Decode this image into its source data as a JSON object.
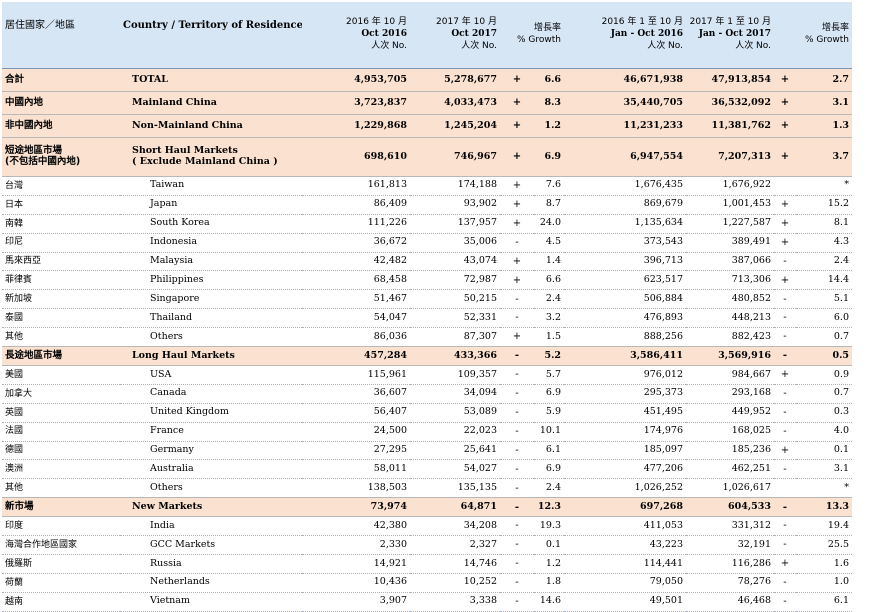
{
  "header": {
    "col_zh": "居住國家／地區",
    "col_en": "Country / Territory of Residence",
    "oct2016": {
      "line1": "2016 年 10 月",
      "line2": "Oct 2016",
      "line3": "人次  No."
    },
    "oct2017": {
      "line1": "2017 年 10 月",
      "line2": "Oct 2017",
      "line3": "人次  No."
    },
    "growth_oct": {
      "line1": "增長率",
      "line2": "% Growth"
    },
    "ytd2016": {
      "line1": "2016 年 1 至 10 月",
      "line2": "Jan - Oct 2016",
      "line3": "人次  No."
    },
    "ytd2017": {
      "line1": "2017 年 1 至 10 月",
      "line2": "Jan - Oct 2017",
      "line3": "人次  No."
    },
    "growth_ytd": {
      "line1": "增長率",
      "line2": "% Growth"
    }
  },
  "rows": [
    {
      "type": "summary",
      "zh": "合計",
      "en": "TOTAL",
      "oct16": "4,953,705",
      "oct17": "5,278,677",
      "s1": "+",
      "g1": "6.6",
      "ytd16": "46,671,938",
      "ytd17": "47,913,854",
      "s2": "+",
      "g2": "2.7"
    },
    {
      "type": "summary",
      "zh": "中國內地",
      "en": "Mainland China",
      "oct16": "3,723,837",
      "oct17": "4,033,473",
      "s1": "+",
      "g1": "8.3",
      "ytd16": "35,440,705",
      "ytd17": "36,532,092",
      "s2": "+",
      "g2": "3.1"
    },
    {
      "type": "summary",
      "zh": "非中國內地",
      "en": "Non-Mainland China",
      "oct16": "1,229,868",
      "oct17": "1,245,204",
      "s1": "+",
      "g1": "1.2",
      "ytd16": "11,231,233",
      "ytd17": "11,381,762",
      "s2": "+",
      "g2": "1.3"
    },
    {
      "type": "cat2",
      "zh": "短途地區市場",
      "zh2": "(不包括中國內地)",
      "en": "Short Haul Markets",
      "en2": "( Exclude Mainland China )",
      "oct16": "698,610",
      "oct17": "746,967",
      "s1": "+",
      "g1": "6.9",
      "ytd16": "6,947,554",
      "ytd17": "7,207,313",
      "s2": "+",
      "g2": "3.7"
    },
    {
      "type": "sub",
      "zh": "台灣",
      "en": "Taiwan",
      "oct16": "161,813",
      "oct17": "174,188",
      "s1": "+",
      "g1": "7.6",
      "ytd16": "1,676,435",
      "ytd17": "1,676,922",
      "s2": "",
      "g2": "*"
    },
    {
      "type": "sub",
      "zh": "日本",
      "en": "Japan",
      "oct16": "86,409",
      "oct17": "93,902",
      "s1": "+",
      "g1": "8.7",
      "ytd16": "869,679",
      "ytd17": "1,001,453",
      "s2": "+",
      "g2": "15.2"
    },
    {
      "type": "sub",
      "zh": "南韓",
      "en": "South Korea",
      "oct16": "111,226",
      "oct17": "137,957",
      "s1": "+",
      "g1": "24.0",
      "ytd16": "1,135,634",
      "ytd17": "1,227,587",
      "s2": "+",
      "g2": "8.1"
    },
    {
      "type": "sub",
      "zh": "印尼",
      "en": "Indonesia",
      "oct16": "36,672",
      "oct17": "35,006",
      "s1": "-",
      "g1": "4.5",
      "ytd16": "373,543",
      "ytd17": "389,491",
      "s2": "+",
      "g2": "4.3"
    },
    {
      "type": "sub",
      "zh": "馬來西亞",
      "en": "Malaysia",
      "oct16": "42,482",
      "oct17": "43,074",
      "s1": "+",
      "g1": "1.4",
      "ytd16": "396,713",
      "ytd17": "387,066",
      "s2": "-",
      "g2": "2.4"
    },
    {
      "type": "sub",
      "zh": "菲律賓",
      "en": "Philippines",
      "oct16": "68,458",
      "oct17": "72,987",
      "s1": "+",
      "g1": "6.6",
      "ytd16": "623,517",
      "ytd17": "713,306",
      "s2": "+",
      "g2": "14.4"
    },
    {
      "type": "sub",
      "zh": "新加坡",
      "en": "Singapore",
      "oct16": "51,467",
      "oct17": "50,215",
      "s1": "-",
      "g1": "2.4",
      "ytd16": "506,884",
      "ytd17": "480,852",
      "s2": "-",
      "g2": "5.1"
    },
    {
      "type": "sub",
      "zh": "泰國",
      "en": "Thailand",
      "oct16": "54,047",
      "oct17": "52,331",
      "s1": "-",
      "g1": "3.2",
      "ytd16": "476,893",
      "ytd17": "448,213",
      "s2": "-",
      "g2": "6.0"
    },
    {
      "type": "sub",
      "zh": "其他",
      "en": "Others",
      "oct16": "86,036",
      "oct17": "87,307",
      "s1": "+",
      "g1": "1.5",
      "ytd16": "888,256",
      "ytd17": "882,423",
      "s2": "-",
      "g2": "0.7"
    },
    {
      "type": "cat",
      "zh": "長途地區市場",
      "en": "Long Haul Markets",
      "oct16": "457,284",
      "oct17": "433,366",
      "s1": "-",
      "g1": "5.2",
      "ytd16": "3,586,411",
      "ytd17": "3,569,916",
      "s2": "-",
      "g2": "0.5"
    },
    {
      "type": "sub",
      "zh": "美國",
      "en": "USA",
      "oct16": "115,961",
      "oct17": "109,357",
      "s1": "-",
      "g1": "5.7",
      "ytd16": "976,012",
      "ytd17": "984,667",
      "s2": "+",
      "g2": "0.9"
    },
    {
      "type": "sub",
      "zh": "加拿大",
      "en": "Canada",
      "oct16": "36,607",
      "oct17": "34,094",
      "s1": "-",
      "g1": "6.9",
      "ytd16": "295,373",
      "ytd17": "293,168",
      "s2": "-",
      "g2": "0.7"
    },
    {
      "type": "sub",
      "zh": "英國",
      "en": "United Kingdom",
      "oct16": "56,407",
      "oct17": "53,089",
      "s1": "-",
      "g1": "5.9",
      "ytd16": "451,495",
      "ytd17": "449,952",
      "s2": "-",
      "g2": "0.3"
    },
    {
      "type": "sub",
      "zh": "法國",
      "en": "France",
      "oct16": "24,500",
      "oct17": "22,023",
      "s1": "-",
      "g1": "10.1",
      "ytd16": "174,976",
      "ytd17": "168,025",
      "s2": "-",
      "g2": "4.0"
    },
    {
      "type": "sub",
      "zh": "德國",
      "en": "Germany",
      "oct16": "27,295",
      "oct17": "25,641",
      "s1": "-",
      "g1": "6.1",
      "ytd16": "185,097",
      "ytd17": "185,236",
      "s2": "+",
      "g2": "0.1"
    },
    {
      "type": "sub",
      "zh": "澳洲",
      "en": "Australia",
      "oct16": "58,011",
      "oct17": "54,027",
      "s1": "-",
      "g1": "6.9",
      "ytd16": "477,206",
      "ytd17": "462,251",
      "s2": "-",
      "g2": "3.1"
    },
    {
      "type": "sub",
      "zh": "其他",
      "en": "Others",
      "oct16": "138,503",
      "oct17": "135,135",
      "s1": "-",
      "g1": "2.4",
      "ytd16": "1,026,252",
      "ytd17": "1,026,617",
      "s2": "",
      "g2": "*"
    },
    {
      "type": "cat",
      "zh": "新市場",
      "en": "New Markets",
      "oct16": "73,974",
      "oct17": "64,871",
      "s1": "-",
      "g1": "12.3",
      "ytd16": "697,268",
      "ytd17": "604,533",
      "s2": "-",
      "g2": "13.3"
    },
    {
      "type": "sub",
      "zh": "印度",
      "en": "India",
      "oct16": "42,380",
      "oct17": "34,208",
      "s1": "-",
      "g1": "19.3",
      "ytd16": "411,053",
      "ytd17": "331,312",
      "s2": "-",
      "g2": "19.4"
    },
    {
      "type": "sub",
      "zh": "海灣合作地區國家",
      "en": "GCC Markets",
      "oct16": "2,330",
      "oct17": "2,327",
      "s1": "-",
      "g1": "0.1",
      "ytd16": "43,223",
      "ytd17": "32,191",
      "s2": "-",
      "g2": "25.5"
    },
    {
      "type": "sub",
      "zh": "俄羅斯",
      "en": "Russia",
      "oct16": "14,921",
      "oct17": "14,746",
      "s1": "-",
      "g1": "1.2",
      "ytd16": "114,441",
      "ytd17": "116,286",
      "s2": "+",
      "g2": "1.6"
    },
    {
      "type": "sub",
      "zh": "荷蘭",
      "en": "Netherlands",
      "oct16": "10,436",
      "oct17": "10,252",
      "s1": "-",
      "g1": "1.8",
      "ytd16": "79,050",
      "ytd17": "78,276",
      "s2": "-",
      "g2": "1.0"
    },
    {
      "type": "sub",
      "zh": "越南",
      "en": "Vietnam",
      "oct16": "3,907",
      "oct17": "3,338",
      "s1": "-",
      "g1": "14.6",
      "ytd16": "49,501",
      "ytd17": "46,468",
      "s2": "-",
      "g2": "6.1"
    }
  ]
}
